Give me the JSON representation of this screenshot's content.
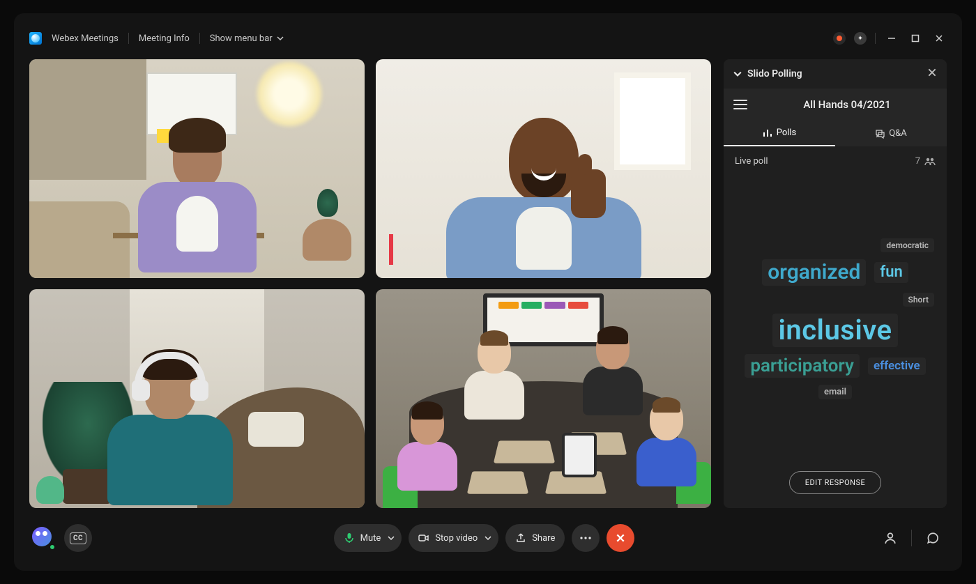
{
  "titlebar": {
    "app_name": "Webex Meetings",
    "meeting_info": "Meeting Info",
    "show_menu": "Show menu bar"
  },
  "panel": {
    "header": "Slido Polling",
    "title": "All Hands 04/2021",
    "tabs": {
      "polls": "Polls",
      "qa": "Q&A"
    },
    "live_label": "Live poll",
    "participant_count": "7",
    "words": {
      "democratic": "democratic",
      "organized": "organized",
      "fun": "fun",
      "short": "Short",
      "inclusive": "inclusive",
      "participatory": "participatory",
      "effective": "effective",
      "email": "email"
    },
    "edit_button": "EDIT RESPONSE"
  },
  "toolbar": {
    "cc": "CC",
    "mute": "Mute",
    "stop_video": "Stop video",
    "share": "Share"
  }
}
